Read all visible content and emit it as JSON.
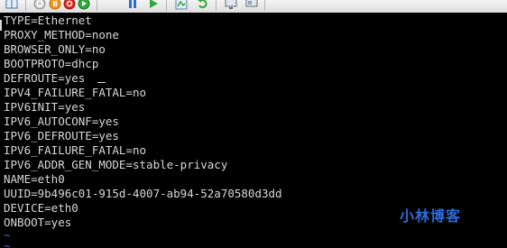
{
  "toolbar": {
    "buttons": [
      {
        "icon": "console-view-icon"
      },
      {
        "icon": "power-off-icon"
      },
      {
        "icon": "suspend-icon"
      },
      {
        "icon": "stop-icon"
      },
      {
        "icon": "power-on-icon"
      },
      {
        "icon": "pause-icon"
      },
      {
        "icon": "play-icon"
      },
      {
        "icon": "snapshot-icon"
      },
      {
        "icon": "revert-icon"
      },
      {
        "icon": "fullscreen-icon"
      },
      {
        "icon": "unity-icon"
      }
    ]
  },
  "terminal": {
    "lines": [
      "TYPE=Ethernet",
      "PROXY_METHOD=none",
      "BROWSER_ONLY=no",
      "BOOTPROTO=dhcp",
      "DEFROUTE=yes",
      "IPV4_FAILURE_FATAL=no",
      "IPV6INIT=yes",
      "IPV6_AUTOCONF=yes",
      "IPV6_DEFROUTE=yes",
      "IPV6_FAILURE_FATAL=no",
      "IPV6_ADDR_GEN_MODE=stable-privacy",
      "NAME=eth0",
      "UUID=9b496c01-915d-4007-ab94-52a70580d3dd",
      "DEVICE=eth0",
      "ONBOOT=yes"
    ],
    "tilde_lines": [
      "~",
      "~"
    ]
  },
  "watermark": {
    "text": "小林博客"
  },
  "colors": {
    "terminal_bg": "#000000",
    "terminal_text": "#d8d8d8",
    "tilde": "#3a6fe0",
    "watermark": "#2d6bd6"
  }
}
